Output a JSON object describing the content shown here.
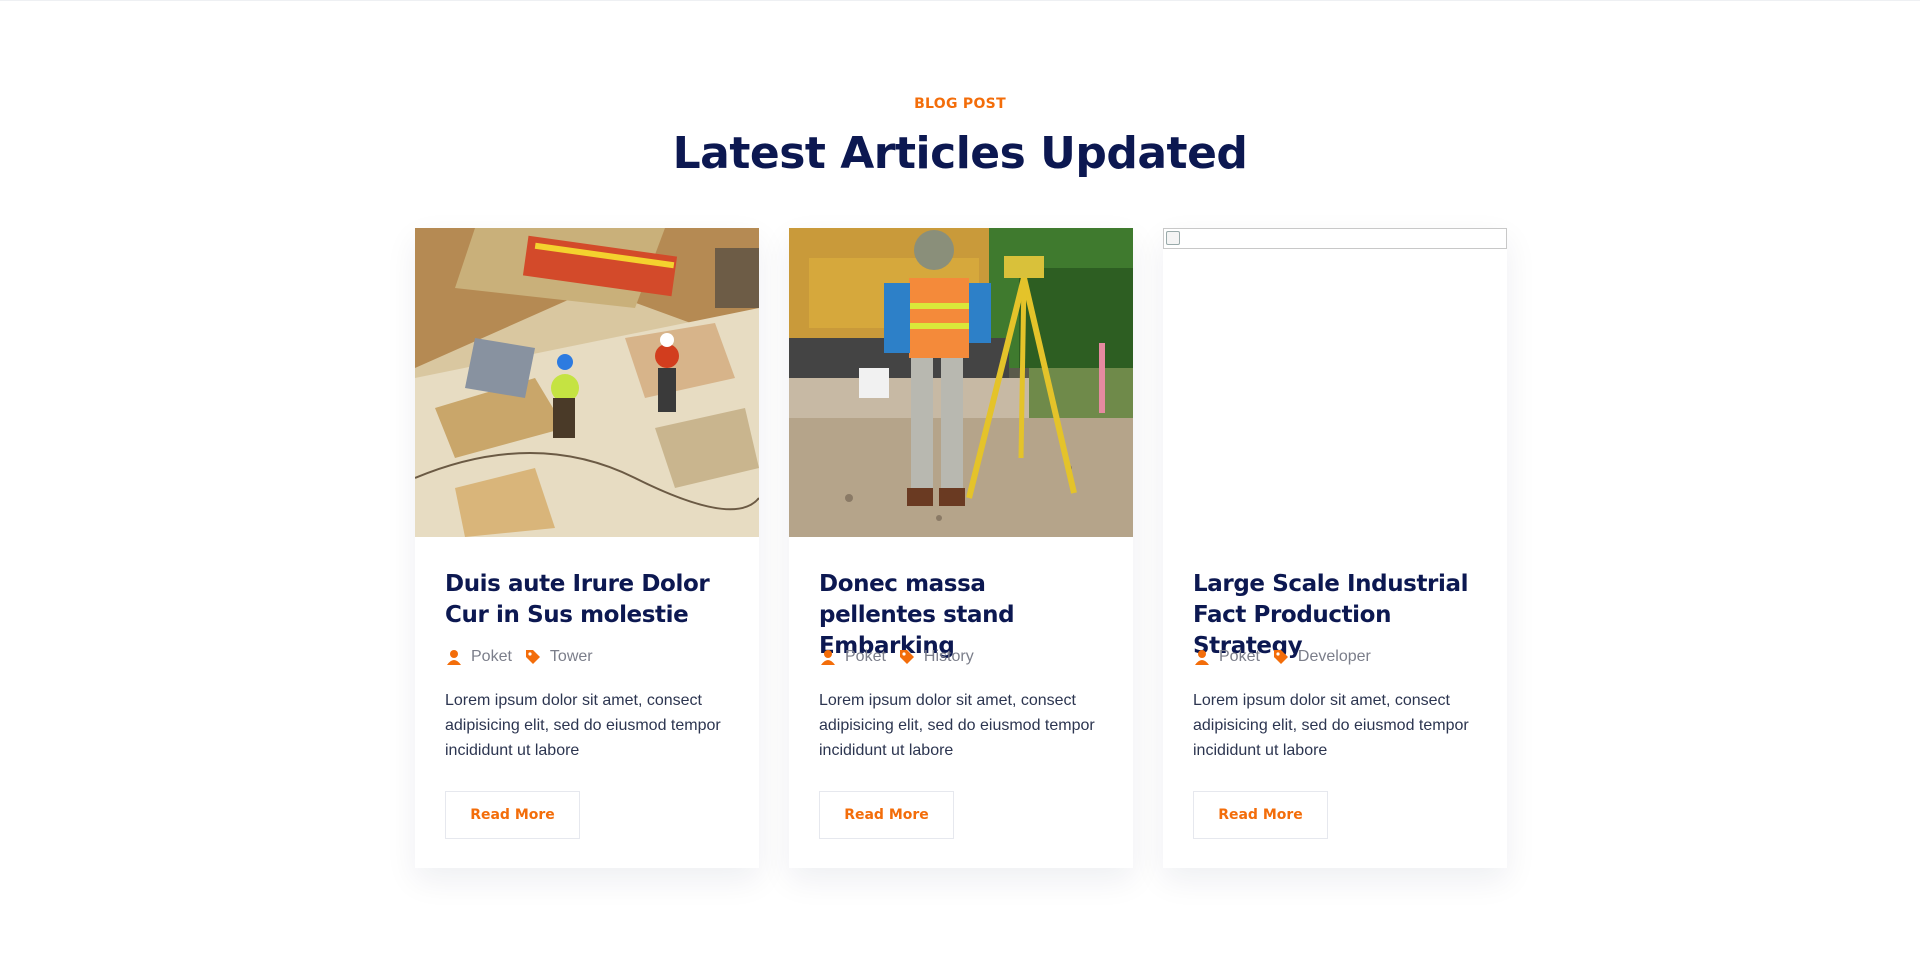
{
  "section": {
    "eyebrow": "BLOG POST",
    "heading": "Latest Articles Updated"
  },
  "colors": {
    "accent": "#f36d0a",
    "heading": "#0c1851",
    "text": "#2c3550",
    "meta": "#7b7e8a"
  },
  "posts": [
    {
      "title": "Duis aute Irure Dolor Cur in Sus molestie",
      "author": "Poket",
      "tag": "Tower",
      "excerpt": "Lorem ipsum dolor sit amet, consect adipisicing elit, sed do eiusmod tempor incididunt ut labore",
      "cta": "Read More",
      "image": "construction-workers-photo"
    },
    {
      "title": "Donec massa pellentes stand Embarking",
      "author": "Poket",
      "tag": "History",
      "excerpt": "Lorem ipsum dolor sit amet, consect adipisicing elit, sed do eiusmod tempor incididunt ut labore",
      "cta": "Read More",
      "image": "surveyor-tripod-photo"
    },
    {
      "title": "Large Scale Industrial Fact Production Strategy",
      "author": "Poket",
      "tag": "Developer",
      "excerpt": "Lorem ipsum dolor sit amet, consect adipisicing elit, sed do eiusmod tempor incididunt ut labore",
      "cta": "Read More",
      "image": "broken-image"
    }
  ],
  "icons": {
    "author": "user-icon",
    "tag": "tag-icon"
  }
}
